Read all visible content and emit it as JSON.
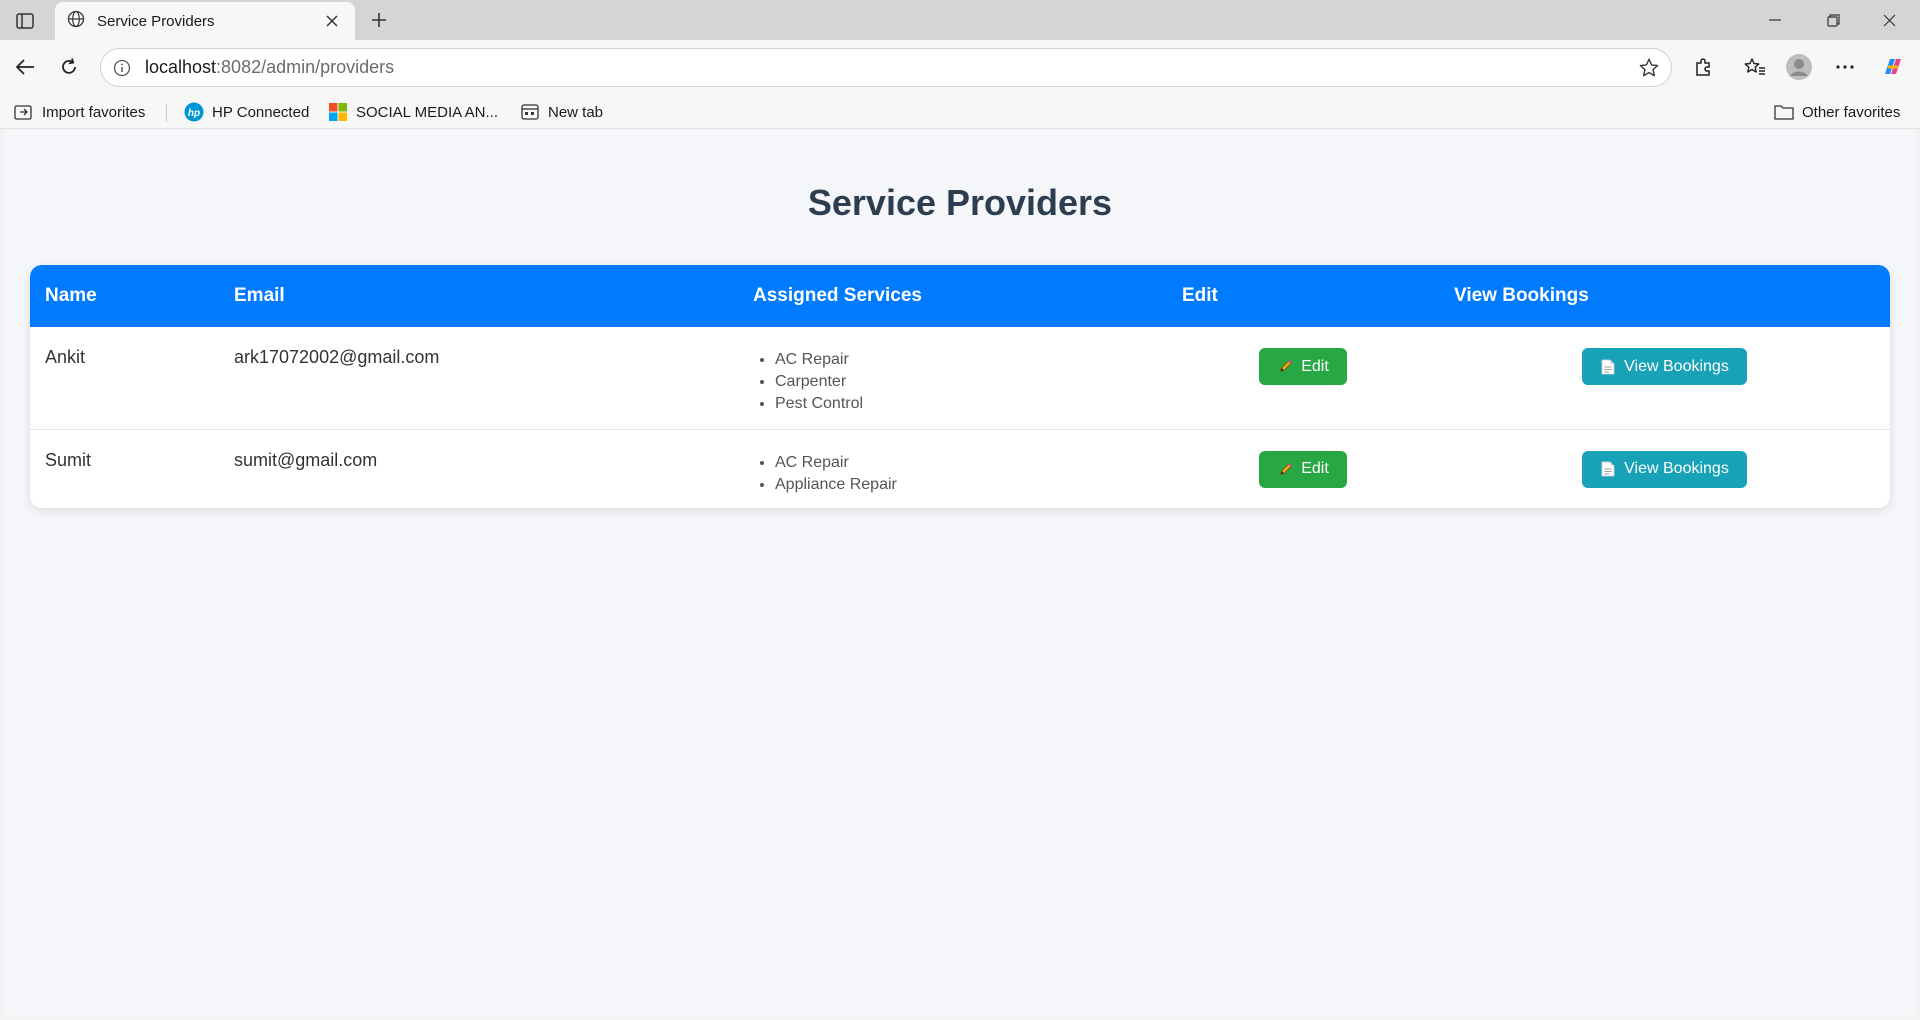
{
  "browser": {
    "tab_title": "Service Providers",
    "url_host": "localhost",
    "url_path": ":8082/admin/providers",
    "favorites": [
      {
        "label": "Import favorites"
      },
      {
        "label": "HP Connected"
      },
      {
        "label": "SOCIAL MEDIA AN..."
      },
      {
        "label": "New tab"
      }
    ],
    "other_favorites": "Other favorites"
  },
  "page": {
    "title": "Service Providers",
    "columns": [
      "Name",
      "Email",
      "Assigned Services",
      "Edit",
      "View Bookings"
    ],
    "providers": [
      {
        "name": "Ankit",
        "email": "ark17072002@gmail.com",
        "services": [
          "AC Repair",
          "Carpenter",
          "Pest Control"
        ],
        "edit_label": "Edit",
        "view_label": "View Bookings"
      },
      {
        "name": "Sumit",
        "email": "sumit@gmail.com",
        "services": [
          "AC Repair",
          "Appliance Repair"
        ],
        "edit_label": "Edit",
        "view_label": "View Bookings"
      }
    ]
  },
  "colors": {
    "header_bg": "#007bff",
    "edit_btn": "#28a745",
    "view_btn": "#17a2b8",
    "title": "#2c3e50"
  }
}
